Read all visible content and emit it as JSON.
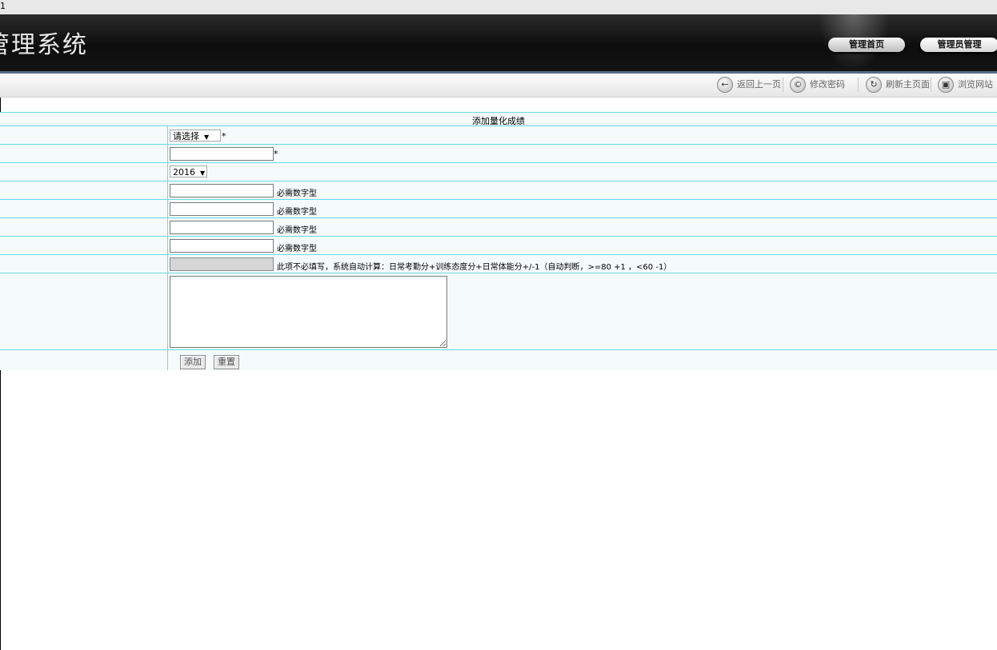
{
  "window": {
    "tab_fragment": "1"
  },
  "header": {
    "title": "管理系统"
  },
  "nav": {
    "home": "管理首页",
    "admin": "管理员管理"
  },
  "toolbar": [
    {
      "label": "返回上一页",
      "icon": "back-arrow-icon",
      "glyph": "←"
    },
    {
      "label": "修改密码",
      "icon": "password-icon",
      "glyph": "©"
    },
    {
      "label": "刷新主页面",
      "icon": "refresh-icon",
      "glyph": "↻"
    },
    {
      "label": "浏览网站",
      "icon": "browse-icon",
      "glyph": "▣"
    }
  ],
  "form": {
    "title": "添加量化成绩",
    "student_select": {
      "value": "请选择"
    },
    "required_mark": "*",
    "year_select": {
      "value": "2016"
    },
    "numeric_hint": "必需数字型",
    "auto_hint": "此项不必填写，系统自动计算：日常考勤分+训练态度分+日常体能分+/-1（自动判断，>=80 +1 ，<60 -1）",
    "buttons": {
      "submit": "添加",
      "reset": "重置"
    }
  },
  "colors": {
    "header_bg": "#111111",
    "grid_line": "#6bd8e8",
    "row_bg": "#f5fbfb",
    "header_strip": "#5a6b88"
  }
}
